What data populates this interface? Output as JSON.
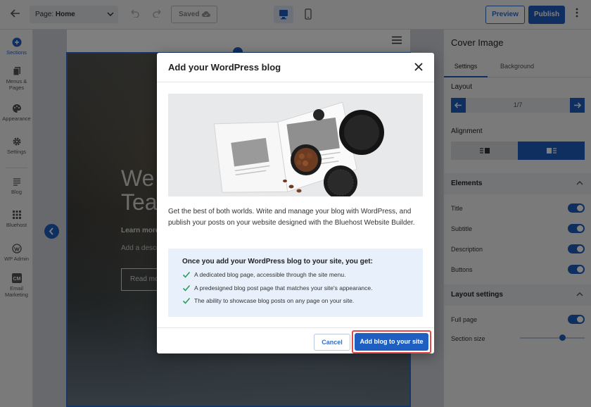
{
  "topbar": {
    "page_label": "Page:",
    "page_value": "Home",
    "saved_label": "Saved",
    "preview_label": "Preview",
    "publish_label": "Publish"
  },
  "leftrail": {
    "items": [
      {
        "label": "Sections",
        "icon": "plus-circle-icon"
      },
      {
        "label": "Menus & Pages",
        "icon": "pages-icon"
      },
      {
        "label": "Appearance",
        "icon": "palette-icon"
      },
      {
        "label": "Settings",
        "icon": "gear-icon"
      },
      {
        "label": "Blog",
        "icon": "blog-icon"
      },
      {
        "label": "Bluehost",
        "icon": "grid-icon"
      },
      {
        "label": "WP Admin",
        "icon": "wordpress-icon"
      },
      {
        "label": "Email Marketing",
        "icon": "cm-icon"
      }
    ]
  },
  "canvas": {
    "cover_title_line1": "We",
    "cover_title_line2": "Tea",
    "cover_learn": "Learn more",
    "cover_desc": "Add a descr",
    "cover_button": "Read mo"
  },
  "rightpanel": {
    "title": "Cover Image",
    "tabs": [
      "Settings",
      "Background"
    ],
    "layout_label": "Layout",
    "layout_value": "1/7",
    "alignment_label": "Alignment",
    "elements_label": "Elements",
    "element_toggles": [
      "Title",
      "Subtitle",
      "Description",
      "Buttons"
    ],
    "layout_settings_label": "Layout settings",
    "full_page_label": "Full page",
    "section_size_label": "Section size"
  },
  "modal": {
    "title": "Add your WordPress blog",
    "body": "Get the best of both worlds. Write and manage your blog with WordPress, and publish your posts on your website designed with the Bluehost Website Builder.",
    "benefits_title": "Once you add your WordPress blog to your site, you get:",
    "benefits": [
      "A dedicated blog page, accessible through the site menu.",
      "A predesigned blog post page that matches your site's appearance.",
      "The ability to showcase blog posts on any page on your site."
    ],
    "cancel_label": "Cancel",
    "confirm_label": "Add blog to your site"
  },
  "colors": {
    "accent": "#1f5fc2",
    "highlight_border": "#e34b4b",
    "benefits_bg": "#e7f0fb"
  }
}
